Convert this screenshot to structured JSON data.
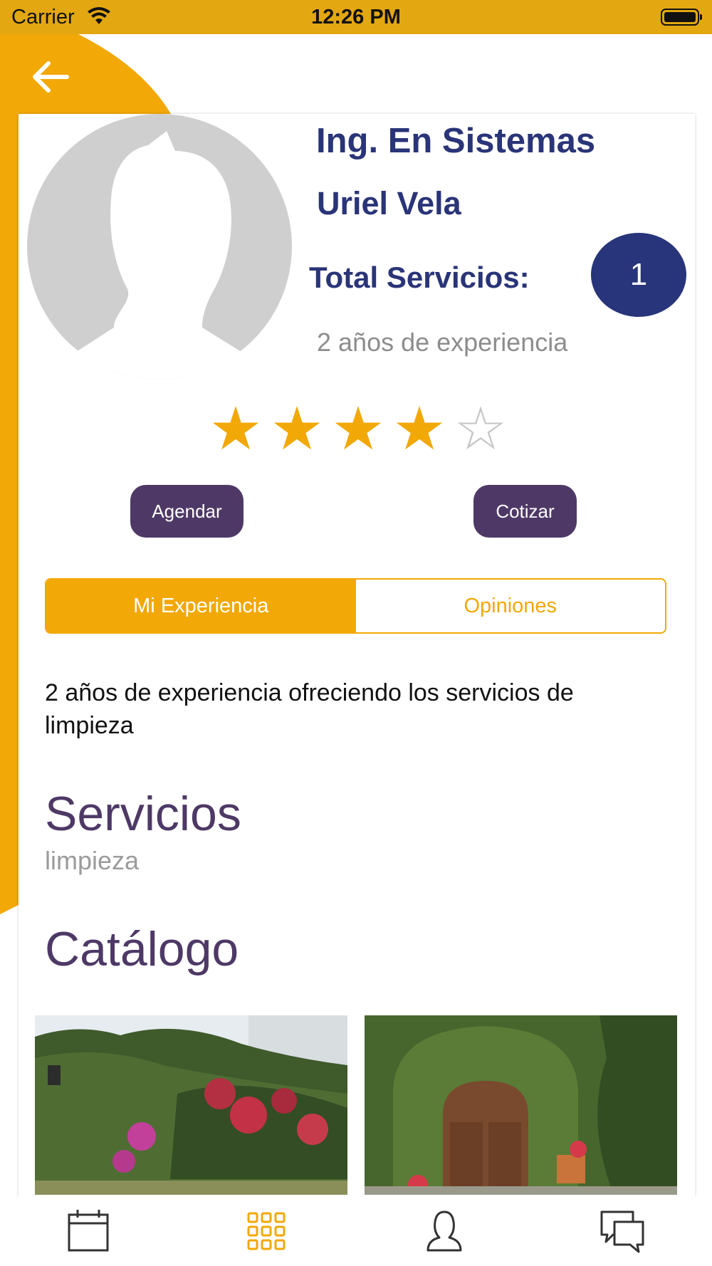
{
  "status_bar": {
    "carrier": "Carrier",
    "time": "12:26 PM"
  },
  "colors": {
    "accent": "#f2a807",
    "navy": "#2a3478",
    "purple": "#4e3966"
  },
  "profile": {
    "degree": "Ing. En Sistemas",
    "name": "Uriel Vela",
    "total_label": "Total Servicios:",
    "total_value": "1",
    "experience_years": "2 años de experiencia",
    "rating": 4,
    "rating_max": 5,
    "stars": [
      "★",
      "★",
      "★",
      "★",
      "☆"
    ]
  },
  "actions": {
    "agendar": "Agendar",
    "cotizar": "Cotizar"
  },
  "tabs": [
    {
      "label": "Mi Experiencia",
      "active": true
    },
    {
      "label": "Opiniones",
      "active": false
    }
  ],
  "description": "2 años de experiencia ofreciendo los servicios de limpieza",
  "services": {
    "title": "Servicios",
    "value": "limpieza"
  },
  "catalog": {
    "title": "Catálogo",
    "images": [
      "garden-wall-photo",
      "garden-door-photo"
    ]
  },
  "tabbar": {
    "items": [
      "calendar-icon",
      "grid-icon",
      "user-icon",
      "chat-icon"
    ],
    "active_index": 1
  }
}
